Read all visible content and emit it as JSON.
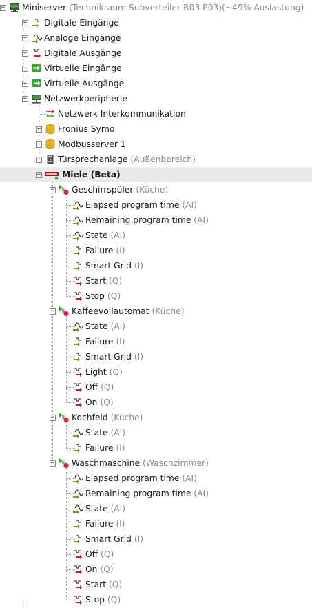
{
  "colors": {
    "selected_row": "#e9e9e9",
    "suffix_text": "#8a8a8a",
    "input_arrow": "#7a9a1e",
    "output_arrow": "#d11a1a",
    "virtual_green": "#3aa832",
    "database_yellow": "#e8b623",
    "status_online": "#3aa832",
    "status_offline": "#e0203a"
  },
  "tree": [
    {
      "text": "Miniserver",
      "suffix": " (Technikraum Subverteiler R03 P03)(~49% Auslastung)",
      "level": 0,
      "icon": "miniserver-icon",
      "toggle": "-",
      "name": "tree-item-miniserver"
    },
    {
      "text": "Digitale Eingänge",
      "suffix": "",
      "level": 1,
      "icon": "digital-input-icon",
      "toggle": "+",
      "name": "tree-item-digitale-eingaenge"
    },
    {
      "text": "Analoge Eingänge",
      "suffix": "",
      "level": 1,
      "icon": "analog-input-icon",
      "toggle": "+",
      "name": "tree-item-analoge-eingaenge"
    },
    {
      "text": "Digitale Ausgänge",
      "suffix": "",
      "level": 1,
      "icon": "digital-output-icon",
      "toggle": "+",
      "name": "tree-item-digitale-ausgaenge"
    },
    {
      "text": "Virtuelle Eingänge",
      "suffix": "",
      "level": 1,
      "icon": "virtual-input-icon",
      "toggle": "+",
      "name": "tree-item-virtuelle-eingaenge"
    },
    {
      "text": "Virtuelle Ausgänge",
      "suffix": "",
      "level": 1,
      "icon": "virtual-output-icon",
      "toggle": "+",
      "name": "tree-item-virtuelle-ausgaenge"
    },
    {
      "text": "Netzwerkperipherie",
      "suffix": "",
      "level": 1,
      "icon": "network-icon",
      "toggle": "-",
      "name": "tree-item-netzwerkperipherie"
    },
    {
      "text": "Netzwerk Interkommunikation",
      "suffix": "",
      "level": 2,
      "icon": "intercommunication-icon",
      "toggle": "",
      "name": "tree-item-netzwerk-interkommunikation"
    },
    {
      "text": "Fronius Symo",
      "suffix": "",
      "level": 2,
      "icon": "database-icon",
      "toggle": "+",
      "name": "tree-item-fronius-symo"
    },
    {
      "text": "Modbusserver 1",
      "suffix": "",
      "level": 2,
      "icon": "database-icon",
      "toggle": "+",
      "name": "tree-item-modbusserver-1"
    },
    {
      "text": "Türsprechanlage",
      "suffix": " (Außenbereich)",
      "level": 2,
      "icon": "intercom-icon",
      "toggle": "+",
      "name": "tree-item-tuersprechanlage"
    },
    {
      "text": "Miele (Beta)",
      "suffix": "",
      "level": 2,
      "icon": "miele-gateway-icon",
      "toggle": "-",
      "name": "tree-item-miele",
      "bold": true,
      "selected": true
    },
    {
      "text": "Geschirrspüler",
      "suffix": " (Küche)",
      "level": 3,
      "icon": "appliance-icon",
      "toggle": "-",
      "name": "tree-item-geschirrspueler"
    },
    {
      "text": "Elapsed program time",
      "suffix": " (AI)",
      "level": 4,
      "icon": "analog-input-icon",
      "toggle": "",
      "name": "tree-item-elapsed-program-time"
    },
    {
      "text": "Remaining program time",
      "suffix": " (AI)",
      "level": 4,
      "icon": "analog-input-icon",
      "toggle": "",
      "name": "tree-item-remaining-program-time"
    },
    {
      "text": "State",
      "suffix": " (AI)",
      "level": 4,
      "icon": "analog-input-icon",
      "toggle": "",
      "name": "tree-item-state"
    },
    {
      "text": "Failure",
      "suffix": " (I)",
      "level": 4,
      "icon": "digital-input-icon",
      "toggle": "",
      "name": "tree-item-failure"
    },
    {
      "text": "Smart Grid",
      "suffix": " (I)",
      "level": 4,
      "icon": "digital-input-icon",
      "toggle": "",
      "name": "tree-item-smart-grid"
    },
    {
      "text": "Start",
      "suffix": " (Q)",
      "level": 4,
      "icon": "digital-output-icon",
      "toggle": "",
      "name": "tree-item-start"
    },
    {
      "text": "Stop",
      "suffix": " (Q)",
      "level": 4,
      "icon": "digital-output-icon",
      "toggle": "",
      "name": "tree-item-stop"
    },
    {
      "text": "Kaffeevollautomat",
      "suffix": " (Küche)",
      "level": 3,
      "icon": "appliance-icon",
      "toggle": "-",
      "name": "tree-item-kaffeevollautomat"
    },
    {
      "text": "State",
      "suffix": " (AI)",
      "level": 4,
      "icon": "analog-input-icon",
      "toggle": "",
      "name": "tree-item-state"
    },
    {
      "text": "Failure",
      "suffix": " (I)",
      "level": 4,
      "icon": "digital-input-icon",
      "toggle": "",
      "name": "tree-item-failure"
    },
    {
      "text": "Smart Grid",
      "suffix": " (I)",
      "level": 4,
      "icon": "digital-input-icon",
      "toggle": "",
      "name": "tree-item-smart-grid"
    },
    {
      "text": "Light",
      "suffix": " (Q)",
      "level": 4,
      "icon": "digital-output-icon",
      "toggle": "",
      "name": "tree-item-light"
    },
    {
      "text": "Off",
      "suffix": " (Q)",
      "level": 4,
      "icon": "digital-output-icon",
      "toggle": "",
      "name": "tree-item-off"
    },
    {
      "text": "On",
      "suffix": " (Q)",
      "level": 4,
      "icon": "digital-output-icon",
      "toggle": "",
      "name": "tree-item-on"
    },
    {
      "text": "Kochfeld",
      "suffix": " (Küche)",
      "level": 3,
      "icon": "appliance-icon",
      "toggle": "-",
      "name": "tree-item-kochfeld"
    },
    {
      "text": "State",
      "suffix": " (AI)",
      "level": 4,
      "icon": "analog-input-icon",
      "toggle": "",
      "name": "tree-item-state"
    },
    {
      "text": "Failure",
      "suffix": " (I)",
      "level": 4,
      "icon": "digital-input-icon",
      "toggle": "",
      "name": "tree-item-failure"
    },
    {
      "text": "Waschmaschine",
      "suffix": " (Waschzimmer)",
      "level": 3,
      "icon": "appliance-icon",
      "toggle": "-",
      "name": "tree-item-waschmaschine"
    },
    {
      "text": "Elapsed program time",
      "suffix": " (AI)",
      "level": 4,
      "icon": "analog-input-icon",
      "toggle": "",
      "name": "tree-item-elapsed-program-time"
    },
    {
      "text": "Remaining program time",
      "suffix": " (AI)",
      "level": 4,
      "icon": "analog-input-icon",
      "toggle": "",
      "name": "tree-item-remaining-program-time"
    },
    {
      "text": "State",
      "suffix": " (AI)",
      "level": 4,
      "icon": "analog-input-icon",
      "toggle": "",
      "name": "tree-item-state"
    },
    {
      "text": "Failure",
      "suffix": " (I)",
      "level": 4,
      "icon": "digital-input-icon",
      "toggle": "",
      "name": "tree-item-failure"
    },
    {
      "text": "Smart Grid",
      "suffix": " (I)",
      "level": 4,
      "icon": "digital-input-icon",
      "toggle": "",
      "name": "tree-item-smart-grid"
    },
    {
      "text": "Off",
      "suffix": " (Q)",
      "level": 4,
      "icon": "digital-output-icon",
      "toggle": "",
      "name": "tree-item-off"
    },
    {
      "text": "On",
      "suffix": " (Q)",
      "level": 4,
      "icon": "digital-output-icon",
      "toggle": "",
      "name": "tree-item-on"
    },
    {
      "text": "Start",
      "suffix": " (Q)",
      "level": 4,
      "icon": "digital-output-icon",
      "toggle": "",
      "name": "tree-item-start"
    },
    {
      "text": "Stop",
      "suffix": " (Q)",
      "level": 4,
      "icon": "digital-output-icon",
      "toggle": "",
      "name": "tree-item-stop"
    }
  ]
}
